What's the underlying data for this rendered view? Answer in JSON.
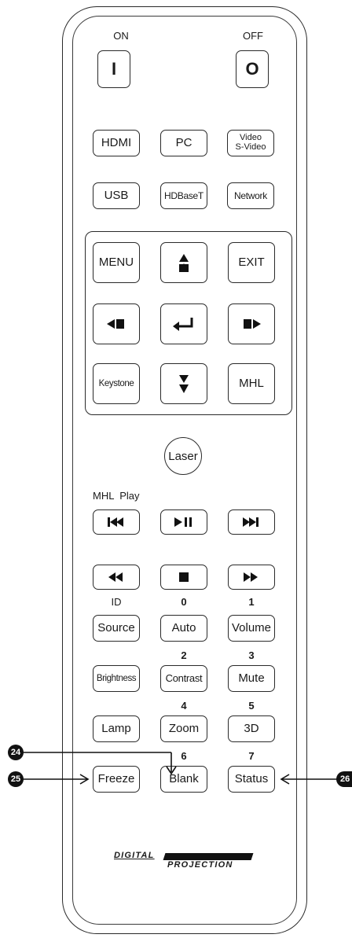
{
  "power": {
    "on_label": "ON",
    "off_label": "OFF",
    "on_symbol": "I",
    "off_symbol": "O"
  },
  "inputs": {
    "hdmi": "HDMI",
    "pc": "PC",
    "video_line1": "Video",
    "video_line2": "S-Video",
    "usb": "USB",
    "hdbaset": "HDBaseT",
    "network": "Network"
  },
  "nav": {
    "menu": "MENU",
    "exit": "EXIT",
    "keystone": "Keystone",
    "mhl": "MHL"
  },
  "laser": "Laser",
  "mhl_play_label": "MHL  Play",
  "numbers": {
    "id": "ID",
    "n0": "0",
    "n1": "1",
    "n2": "2",
    "n3": "3",
    "n4": "4",
    "n5": "5",
    "n6": "6",
    "n7": "7"
  },
  "functions": {
    "source": "Source",
    "auto": "Auto",
    "volume": "Volume",
    "brightness": "Brightness",
    "contrast": "Contrast",
    "mute": "Mute",
    "lamp": "Lamp",
    "zoom": "Zoom",
    "three_d": "3D",
    "freeze": "Freeze",
    "blank": "Blank",
    "status": "Status"
  },
  "callouts": {
    "c24": "24",
    "c25": "25",
    "c26": "26"
  },
  "logo": {
    "line1": "DIGITAL",
    "line2": "PROJECTION"
  }
}
